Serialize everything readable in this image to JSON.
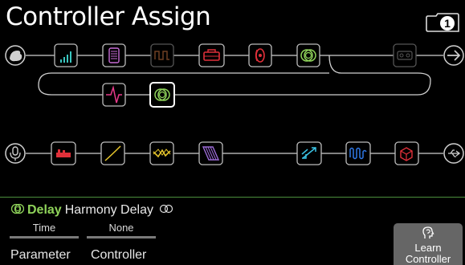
{
  "header": {
    "title": "Controller Assign",
    "snapshot_number": "1"
  },
  "signal_flow": {
    "path_a_row1_blocks": [
      "eq-icon",
      "compressor-icon",
      "modulation-icon",
      "amp-icon",
      "wah-icon",
      "delay-icon"
    ],
    "path_a_row1_empty": [
      "looper-icon"
    ],
    "path_a_row2_blocks": [
      "filter-icon",
      "delay-icon-selected"
    ],
    "path_b_blocks": [
      "distortion-icon",
      "eq-slope-icon",
      "filter-icon",
      "cab-icon",
      "pitch-icon",
      "synth-icon",
      "fx-loop-icon"
    ],
    "input_icons": [
      "guitar-icon",
      "microphone-icon"
    ],
    "output_icons": [
      "arrow-right-icon",
      "usb-icon"
    ]
  },
  "selected_block": {
    "category": "Delay",
    "model": "Harmony Delay",
    "category_color": "#8fd35a"
  },
  "assignment": {
    "parameter_value": "Time",
    "controller_value": "None",
    "parameter_label": "Parameter",
    "controller_label": "Controller"
  },
  "learn_button": {
    "line1": "Learn",
    "line2": "Controller"
  },
  "colors": {
    "accent_green": "#8fd35a",
    "divider_green": "#4b8f3d",
    "selected_block_border": "#ffffff"
  }
}
